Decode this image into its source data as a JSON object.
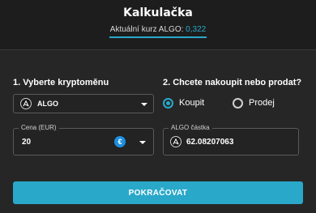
{
  "header": {
    "title": "Kalkulačka",
    "rate_label": "Aktuální kurz ALGO:",
    "rate_value": "0,322"
  },
  "step1": {
    "title": "1. Vyberte kryptoměnu",
    "selected": "ALGO",
    "icon": "algorand-icon"
  },
  "step2": {
    "title": "2. Chcete nakoupit nebo prodat?",
    "options": [
      {
        "label": "Koupit",
        "selected": true
      },
      {
        "label": "Prodej",
        "selected": false
      }
    ]
  },
  "price": {
    "label": "Cena (EUR)",
    "value": "20",
    "currency_icon": "euro-icon"
  },
  "amount": {
    "label": "ALGO částka",
    "value": "62.08207063",
    "icon": "algorand-icon"
  },
  "button": {
    "label": "POKRAČOVAT"
  },
  "colors": {
    "accent": "#29a8c9",
    "background": "#262626",
    "header": "#1d1d1d"
  }
}
